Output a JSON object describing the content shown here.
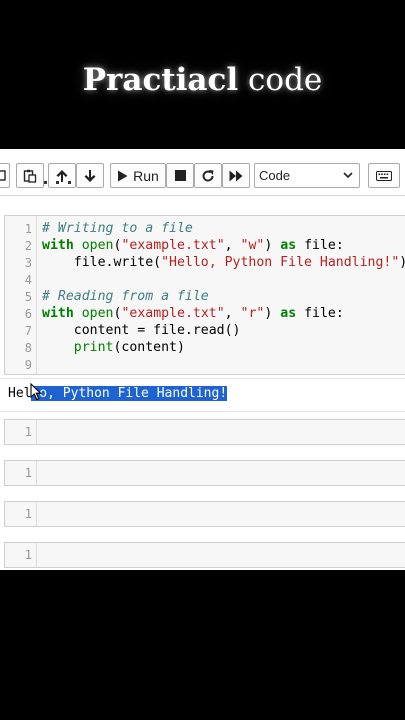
{
  "overlay": {
    "title_bold": "Practiacl",
    "title_normal": "code"
  },
  "toolbar": {
    "run_label": "Run",
    "cell_type": "Code"
  },
  "code_cell": {
    "line_numbers": [
      "1",
      "2",
      "3",
      "4",
      "5",
      "6",
      "7",
      "8",
      "9"
    ],
    "lines": {
      "l1_comment": "# Writing to a file",
      "l2_kw1": "with",
      "l2_fn": "open",
      "l2_p1": "(",
      "l2_s1": "\"example.txt\"",
      "l2_comma": ", ",
      "l2_s2": "\"w\"",
      "l2_p2": ") ",
      "l2_kw2": "as",
      "l2_rest": " file:",
      "l3_pre": "    file.write(",
      "l3_s": "\"Hello, Python File Handling!\"",
      "l3_post": ")",
      "l5_comment": "# Reading from a file",
      "l6_kw1": "with",
      "l6_fn": "open",
      "l6_p1": "(",
      "l6_s1": "\"example.txt\"",
      "l6_comma": ", ",
      "l6_s2": "\"r\"",
      "l6_p2": ") ",
      "l6_kw2": "as",
      "l6_rest": " file:",
      "l7": "    content = file.read()",
      "l8_indent": "    ",
      "l8_fn": "print",
      "l8_rest": "(content)"
    }
  },
  "output": {
    "unselected": "Hel",
    "selected": "lo, Python File Handling!"
  },
  "empty_cells": [
    {
      "line_number": "1"
    },
    {
      "line_number": "1"
    },
    {
      "line_number": "1"
    },
    {
      "line_number": "1"
    }
  ],
  "colors": {
    "keyword": "#008000",
    "string": "#ba2121",
    "comment": "#408080",
    "selection": "#1e63d1",
    "cell_bg": "#f7f7f7"
  }
}
